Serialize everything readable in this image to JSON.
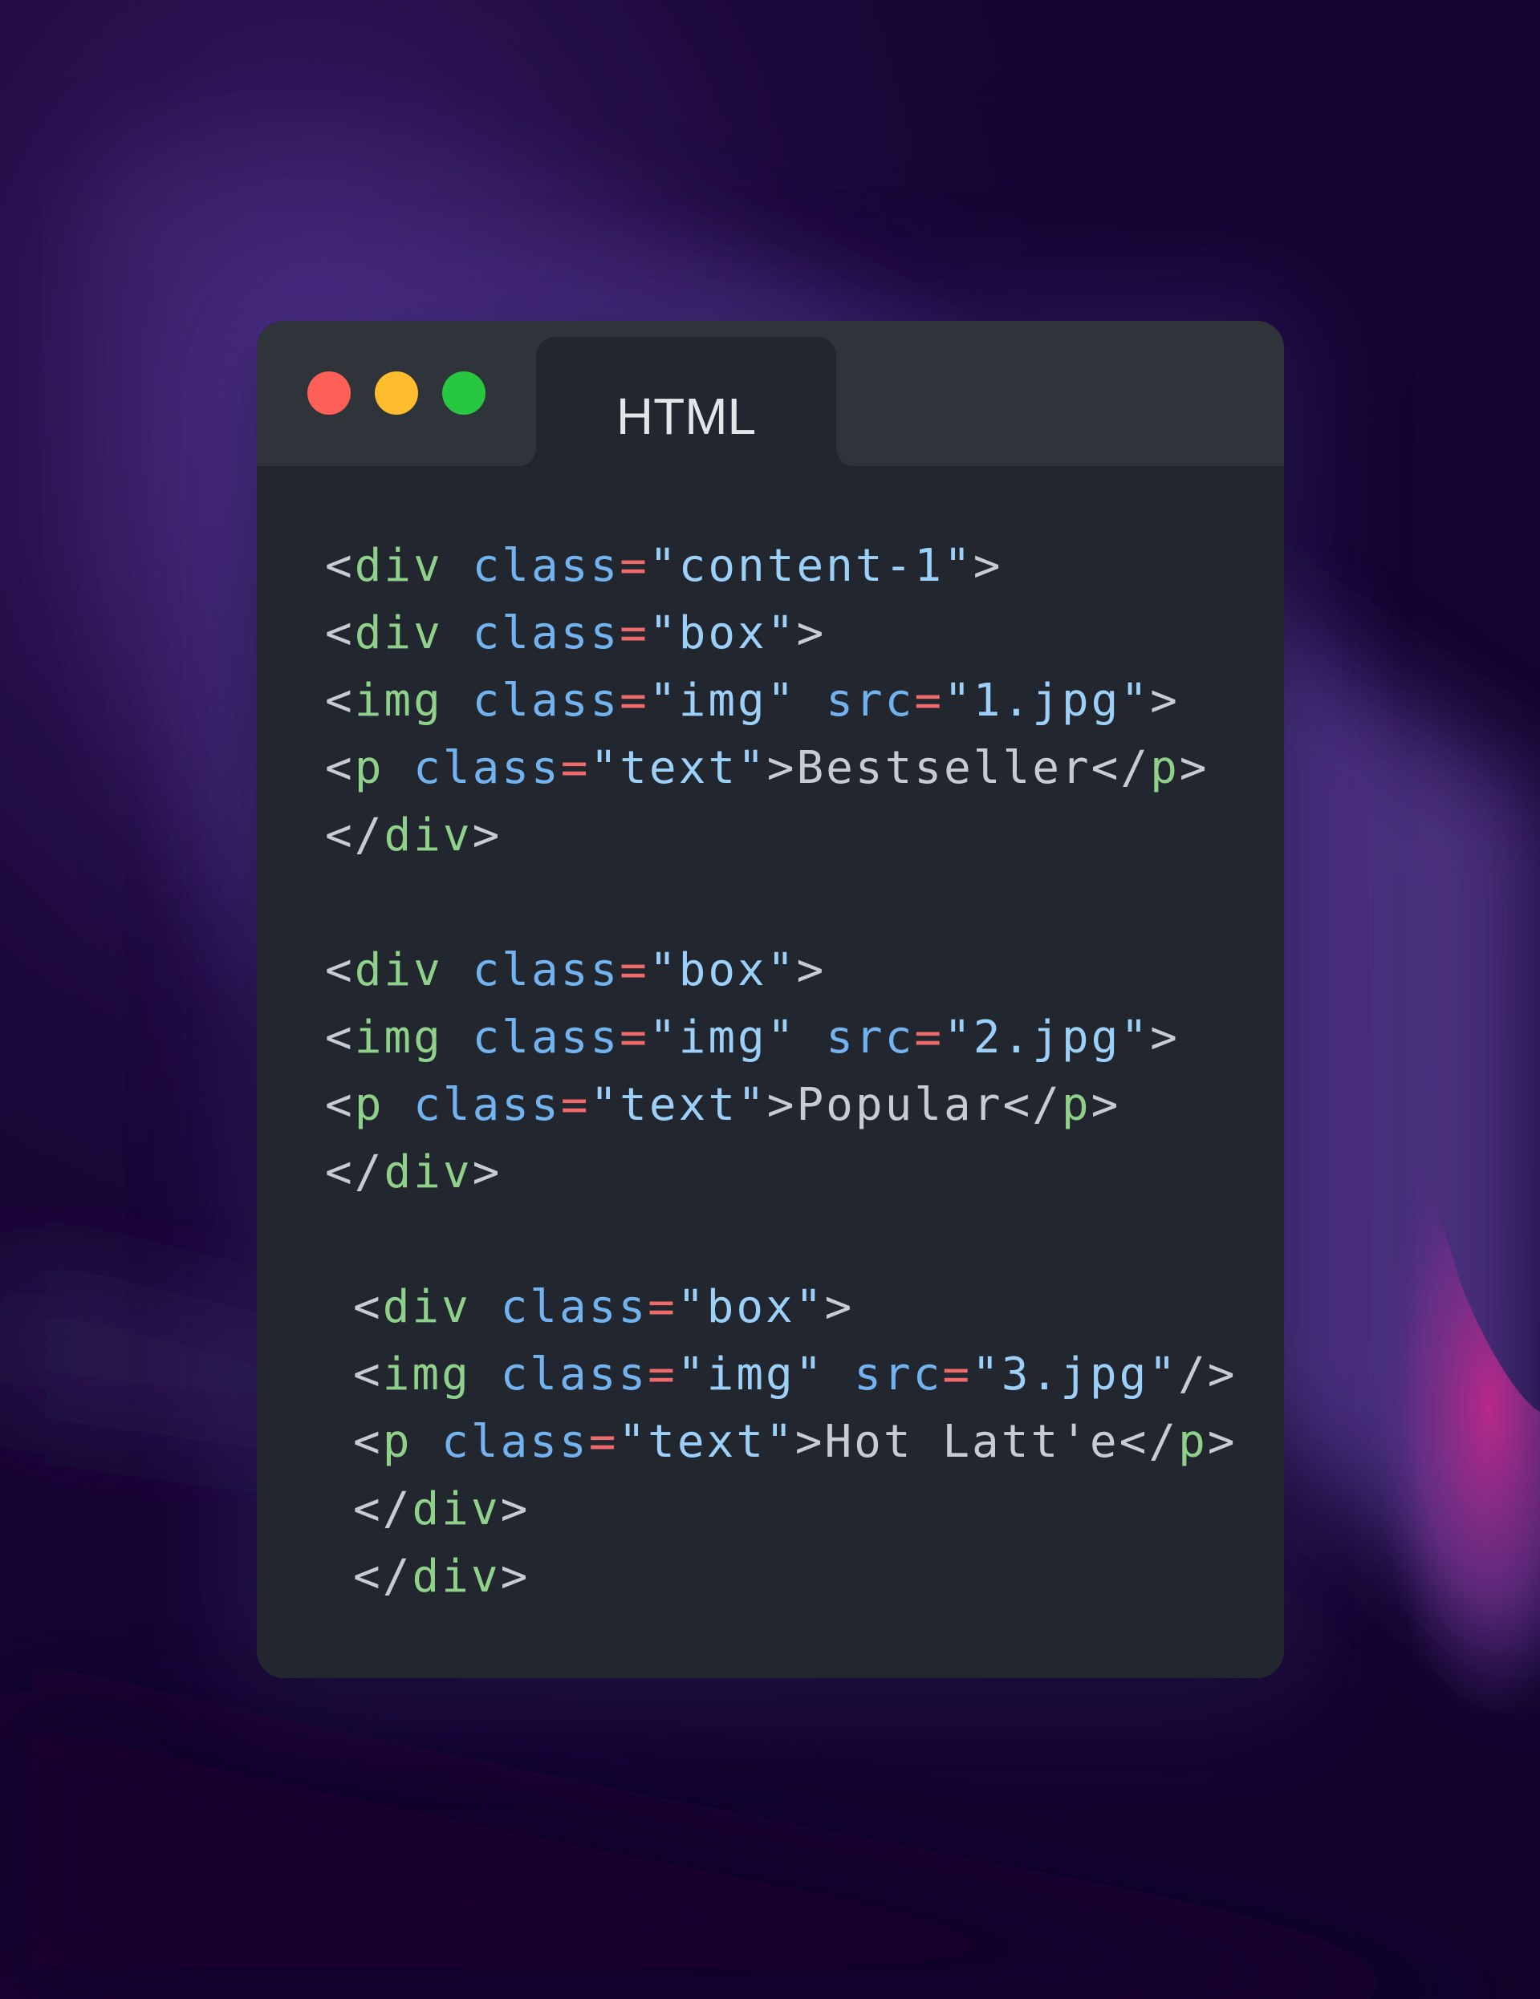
{
  "window": {
    "tab_label": "HTML"
  },
  "colors": {
    "tag": "#8fd18a",
    "attribute": "#72b3ef",
    "equals": "#ef6a6a",
    "string": "#9cd0f8",
    "text": "#c8ccd2"
  },
  "code_lines": [
    {
      "indent": 0,
      "tokens": [
        {
          "t": "punct",
          "v": "<"
        },
        {
          "t": "tag",
          "v": "div"
        },
        {
          "t": "punct",
          "v": " "
        },
        {
          "t": "attr",
          "v": "class"
        },
        {
          "t": "eq",
          "v": "="
        },
        {
          "t": "str",
          "v": "\"content-1\""
        },
        {
          "t": "punct",
          "v": ">"
        }
      ]
    },
    {
      "indent": 0,
      "tokens": [
        {
          "t": "punct",
          "v": "<"
        },
        {
          "t": "tag",
          "v": "div"
        },
        {
          "t": "punct",
          "v": " "
        },
        {
          "t": "attr",
          "v": "class"
        },
        {
          "t": "eq",
          "v": "="
        },
        {
          "t": "str",
          "v": "\"box\""
        },
        {
          "t": "punct",
          "v": ">"
        }
      ]
    },
    {
      "indent": 0,
      "tokens": [
        {
          "t": "punct",
          "v": "<"
        },
        {
          "t": "tag",
          "v": "img"
        },
        {
          "t": "punct",
          "v": " "
        },
        {
          "t": "attr",
          "v": "class"
        },
        {
          "t": "eq",
          "v": "="
        },
        {
          "t": "str",
          "v": "\"img\""
        },
        {
          "t": "punct",
          "v": " "
        },
        {
          "t": "attr",
          "v": "src"
        },
        {
          "t": "eq",
          "v": "="
        },
        {
          "t": "str",
          "v": "\"1.jpg\""
        },
        {
          "t": "punct",
          "v": ">"
        }
      ]
    },
    {
      "indent": 0,
      "tokens": [
        {
          "t": "punct",
          "v": "<"
        },
        {
          "t": "tag",
          "v": "p"
        },
        {
          "t": "punct",
          "v": " "
        },
        {
          "t": "attr",
          "v": "class"
        },
        {
          "t": "eq",
          "v": "="
        },
        {
          "t": "str",
          "v": "\"text\""
        },
        {
          "t": "punct",
          "v": ">"
        },
        {
          "t": "txt",
          "v": "Bestseller"
        },
        {
          "t": "punct",
          "v": "</"
        },
        {
          "t": "tag",
          "v": "p"
        },
        {
          "t": "punct",
          "v": ">"
        }
      ]
    },
    {
      "indent": 0,
      "tokens": [
        {
          "t": "punct",
          "v": "</"
        },
        {
          "t": "tag",
          "v": "div"
        },
        {
          "t": "punct",
          "v": ">"
        }
      ]
    },
    {
      "indent": 0,
      "tokens": []
    },
    {
      "indent": 0,
      "tokens": [
        {
          "t": "punct",
          "v": "<"
        },
        {
          "t": "tag",
          "v": "div"
        },
        {
          "t": "punct",
          "v": " "
        },
        {
          "t": "attr",
          "v": "class"
        },
        {
          "t": "eq",
          "v": "="
        },
        {
          "t": "str",
          "v": "\"box\""
        },
        {
          "t": "punct",
          "v": ">"
        }
      ]
    },
    {
      "indent": 0,
      "tokens": [
        {
          "t": "punct",
          "v": "<"
        },
        {
          "t": "tag",
          "v": "img"
        },
        {
          "t": "punct",
          "v": " "
        },
        {
          "t": "attr",
          "v": "class"
        },
        {
          "t": "eq",
          "v": "="
        },
        {
          "t": "str",
          "v": "\"img\""
        },
        {
          "t": "punct",
          "v": " "
        },
        {
          "t": "attr",
          "v": "src"
        },
        {
          "t": "eq",
          "v": "="
        },
        {
          "t": "str",
          "v": "\"2.jpg\""
        },
        {
          "t": "punct",
          "v": ">"
        }
      ]
    },
    {
      "indent": 0,
      "tokens": [
        {
          "t": "punct",
          "v": "<"
        },
        {
          "t": "tag",
          "v": "p"
        },
        {
          "t": "punct",
          "v": " "
        },
        {
          "t": "attr",
          "v": "class"
        },
        {
          "t": "eq",
          "v": "="
        },
        {
          "t": "str",
          "v": "\"text\""
        },
        {
          "t": "punct",
          "v": ">"
        },
        {
          "t": "txt",
          "v": "Popular"
        },
        {
          "t": "punct",
          "v": "</"
        },
        {
          "t": "tag",
          "v": "p"
        },
        {
          "t": "punct",
          "v": ">"
        }
      ]
    },
    {
      "indent": 0,
      "tokens": [
        {
          "t": "punct",
          "v": "</"
        },
        {
          "t": "tag",
          "v": "div"
        },
        {
          "t": "punct",
          "v": ">"
        }
      ]
    },
    {
      "indent": 0,
      "tokens": []
    },
    {
      "indent": 1,
      "tokens": [
        {
          "t": "punct",
          "v": "<"
        },
        {
          "t": "tag",
          "v": "div"
        },
        {
          "t": "punct",
          "v": " "
        },
        {
          "t": "attr",
          "v": "class"
        },
        {
          "t": "eq",
          "v": "="
        },
        {
          "t": "str",
          "v": "\"box\""
        },
        {
          "t": "punct",
          "v": ">"
        }
      ]
    },
    {
      "indent": 1,
      "tokens": [
        {
          "t": "punct",
          "v": "<"
        },
        {
          "t": "tag",
          "v": "img"
        },
        {
          "t": "punct",
          "v": " "
        },
        {
          "t": "attr",
          "v": "class"
        },
        {
          "t": "eq",
          "v": "="
        },
        {
          "t": "str",
          "v": "\"img\""
        },
        {
          "t": "punct",
          "v": " "
        },
        {
          "t": "attr",
          "v": "src"
        },
        {
          "t": "eq",
          "v": "="
        },
        {
          "t": "str",
          "v": "\"3.jpg\""
        },
        {
          "t": "punct",
          "v": "/>"
        }
      ]
    },
    {
      "indent": 1,
      "tokens": [
        {
          "t": "punct",
          "v": "<"
        },
        {
          "t": "tag",
          "v": "p"
        },
        {
          "t": "punct",
          "v": " "
        },
        {
          "t": "attr",
          "v": "class"
        },
        {
          "t": "eq",
          "v": "="
        },
        {
          "t": "str",
          "v": "\"text\""
        },
        {
          "t": "punct",
          "v": ">"
        },
        {
          "t": "txt",
          "v": "Hot Latt'e"
        },
        {
          "t": "punct",
          "v": "</"
        },
        {
          "t": "tag",
          "v": "p"
        },
        {
          "t": "punct",
          "v": ">"
        }
      ]
    },
    {
      "indent": 1,
      "tokens": [
        {
          "t": "punct",
          "v": "</"
        },
        {
          "t": "tag",
          "v": "div"
        },
        {
          "t": "punct",
          "v": ">"
        }
      ]
    },
    {
      "indent": 1,
      "tokens": [
        {
          "t": "punct",
          "v": "</"
        },
        {
          "t": "tag",
          "v": "div"
        },
        {
          "t": "punct",
          "v": ">"
        }
      ]
    }
  ]
}
